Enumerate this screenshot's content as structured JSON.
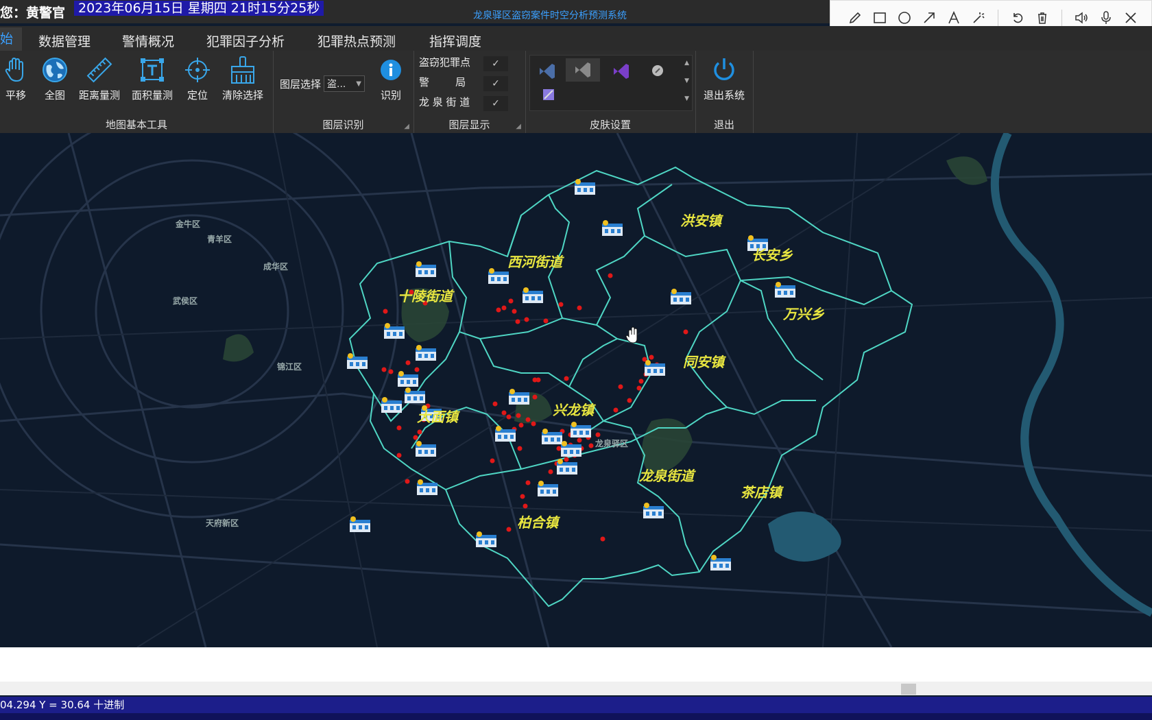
{
  "titlebar": {
    "user": "您：黄警官",
    "datetime": "2023年06月15日  星期四  21时15分25秒",
    "app_title": "龙泉驿区盗窃案件时空分析预测系统"
  },
  "annot_toolbar": {
    "icons": [
      "pencil-icon",
      "rectangle-icon",
      "circle-icon",
      "arrow-icon",
      "text-icon",
      "magic-wand-icon",
      "undo-icon",
      "trash-icon",
      "speaker-icon",
      "microphone-icon",
      "close-icon"
    ]
  },
  "menu": {
    "active": "始",
    "tabs": [
      "数据管理",
      "警情概况",
      "犯罪因子分析",
      "犯罪热点预测",
      "指挥调度"
    ]
  },
  "ribbon": {
    "basic_tools": {
      "label": "地图基本工具",
      "tools": [
        "平移",
        "全图",
        "距离量测",
        "面积量测",
        "定位",
        "清除选择"
      ]
    },
    "layer_identify": {
      "label": "图层识别",
      "layer_select_label": "图层选择",
      "layer_select_value": "盗...",
      "identify_label": "识别"
    },
    "layer_display": {
      "label": "图层显示",
      "layers": [
        {
          "name": "盗窃犯罪点",
          "checked": "✓"
        },
        {
          "name": "警        局",
          "checked": "✓"
        },
        {
          "name": "龙 泉 街 道",
          "checked": "✓"
        }
      ]
    },
    "skin": {
      "label": "皮肤设置"
    },
    "exit": {
      "label": "退出",
      "button": "退出系统"
    }
  },
  "map": {
    "districts": [
      "洪安镇",
      "西河街道",
      "长安乡",
      "十陵街道",
      "万兴乡",
      "同安镇",
      "大面镇",
      "兴龙镇",
      "龙泉街道",
      "茶店镇",
      "柏合镇"
    ],
    "background_labels": [
      "金牛区",
      "青羊区",
      "成华区",
      "武侯区",
      "锦江区",
      "龙泉驿区",
      "天府新区"
    ]
  },
  "status": {
    "coords": "04.294  Y = 30.64  十进制"
  },
  "colors": {
    "boundary": "#4fd6c4",
    "crime_point": "#e01818",
    "district_label": "#e8e640",
    "status_bar": "#1c1e8a"
  }
}
